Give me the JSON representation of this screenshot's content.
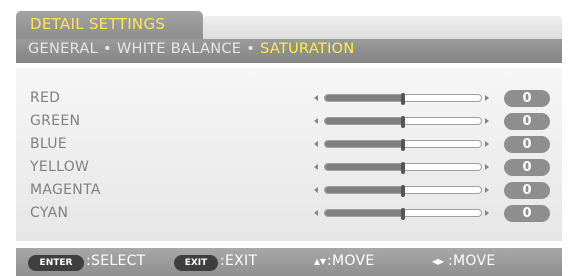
{
  "menu": {
    "title": "DETAIL SETTINGS",
    "breadcrumb": [
      "GENERAL",
      "WHITE BALANCE",
      "SATURATION"
    ],
    "separator": "•",
    "active_index": 2
  },
  "rows": [
    {
      "label": "RED",
      "value": "0",
      "level": 0.5
    },
    {
      "label": "GREEN",
      "value": "0",
      "level": 0.5
    },
    {
      "label": "BLUE",
      "value": "0",
      "level": 0.5
    },
    {
      "label": "YELLOW",
      "value": "0",
      "level": 0.5
    },
    {
      "label": "MAGENTA",
      "value": "0",
      "level": 0.5
    },
    {
      "label": "CYAN",
      "value": "0",
      "level": 0.5
    }
  ],
  "footer": {
    "enter_key": "ENTER",
    "select_label": ":SELECT",
    "exit_key": "EXIT",
    "exit_label": ":EXIT",
    "move_vertical_label": ":MOVE",
    "move_horizontal_label": ":MOVE",
    "up_down_icon": "up-down-arrows-icon",
    "left_right_icon": "left-right-arrows-icon"
  },
  "colors": {
    "title_text": "#ffe74a",
    "active_tab": "#fff236",
    "value_badge": "#8e8e8e",
    "slider_fill": "#7f7f7f"
  }
}
